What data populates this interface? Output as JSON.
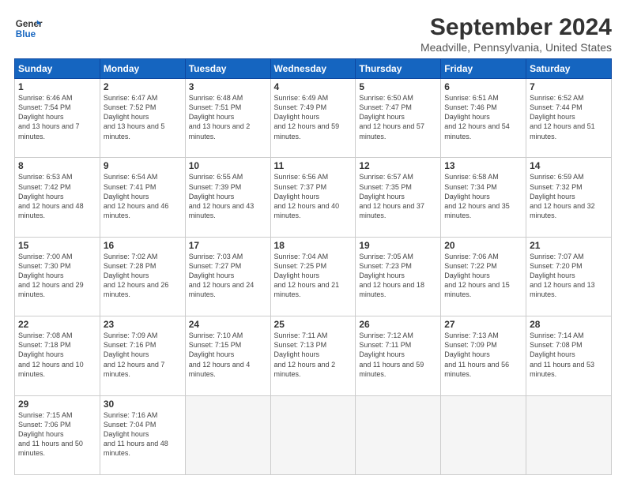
{
  "header": {
    "logo_line1": "General",
    "logo_line2": "Blue",
    "title": "September 2024",
    "subtitle": "Meadville, Pennsylvania, United States"
  },
  "calendar": {
    "days_of_week": [
      "Sunday",
      "Monday",
      "Tuesday",
      "Wednesday",
      "Thursday",
      "Friday",
      "Saturday"
    ],
    "weeks": [
      [
        {
          "num": "1",
          "sunrise": "6:46 AM",
          "sunset": "7:54 PM",
          "daylight": "13 hours and 7 minutes."
        },
        {
          "num": "2",
          "sunrise": "6:47 AM",
          "sunset": "7:52 PM",
          "daylight": "13 hours and 5 minutes."
        },
        {
          "num": "3",
          "sunrise": "6:48 AM",
          "sunset": "7:51 PM",
          "daylight": "13 hours and 2 minutes."
        },
        {
          "num": "4",
          "sunrise": "6:49 AM",
          "sunset": "7:49 PM",
          "daylight": "12 hours and 59 minutes."
        },
        {
          "num": "5",
          "sunrise": "6:50 AM",
          "sunset": "7:47 PM",
          "daylight": "12 hours and 57 minutes."
        },
        {
          "num": "6",
          "sunrise": "6:51 AM",
          "sunset": "7:46 PM",
          "daylight": "12 hours and 54 minutes."
        },
        {
          "num": "7",
          "sunrise": "6:52 AM",
          "sunset": "7:44 PM",
          "daylight": "12 hours and 51 minutes."
        }
      ],
      [
        {
          "num": "8",
          "sunrise": "6:53 AM",
          "sunset": "7:42 PM",
          "daylight": "12 hours and 48 minutes."
        },
        {
          "num": "9",
          "sunrise": "6:54 AM",
          "sunset": "7:41 PM",
          "daylight": "12 hours and 46 minutes."
        },
        {
          "num": "10",
          "sunrise": "6:55 AM",
          "sunset": "7:39 PM",
          "daylight": "12 hours and 43 minutes."
        },
        {
          "num": "11",
          "sunrise": "6:56 AM",
          "sunset": "7:37 PM",
          "daylight": "12 hours and 40 minutes."
        },
        {
          "num": "12",
          "sunrise": "6:57 AM",
          "sunset": "7:35 PM",
          "daylight": "12 hours and 37 minutes."
        },
        {
          "num": "13",
          "sunrise": "6:58 AM",
          "sunset": "7:34 PM",
          "daylight": "12 hours and 35 minutes."
        },
        {
          "num": "14",
          "sunrise": "6:59 AM",
          "sunset": "7:32 PM",
          "daylight": "12 hours and 32 minutes."
        }
      ],
      [
        {
          "num": "15",
          "sunrise": "7:00 AM",
          "sunset": "7:30 PM",
          "daylight": "12 hours and 29 minutes."
        },
        {
          "num": "16",
          "sunrise": "7:02 AM",
          "sunset": "7:28 PM",
          "daylight": "12 hours and 26 minutes."
        },
        {
          "num": "17",
          "sunrise": "7:03 AM",
          "sunset": "7:27 PM",
          "daylight": "12 hours and 24 minutes."
        },
        {
          "num": "18",
          "sunrise": "7:04 AM",
          "sunset": "7:25 PM",
          "daylight": "12 hours and 21 minutes."
        },
        {
          "num": "19",
          "sunrise": "7:05 AM",
          "sunset": "7:23 PM",
          "daylight": "12 hours and 18 minutes."
        },
        {
          "num": "20",
          "sunrise": "7:06 AM",
          "sunset": "7:22 PM",
          "daylight": "12 hours and 15 minutes."
        },
        {
          "num": "21",
          "sunrise": "7:07 AM",
          "sunset": "7:20 PM",
          "daylight": "12 hours and 13 minutes."
        }
      ],
      [
        {
          "num": "22",
          "sunrise": "7:08 AM",
          "sunset": "7:18 PM",
          "daylight": "12 hours and 10 minutes."
        },
        {
          "num": "23",
          "sunrise": "7:09 AM",
          "sunset": "7:16 PM",
          "daylight": "12 hours and 7 minutes."
        },
        {
          "num": "24",
          "sunrise": "7:10 AM",
          "sunset": "7:15 PM",
          "daylight": "12 hours and 4 minutes."
        },
        {
          "num": "25",
          "sunrise": "7:11 AM",
          "sunset": "7:13 PM",
          "daylight": "12 hours and 2 minutes."
        },
        {
          "num": "26",
          "sunrise": "7:12 AM",
          "sunset": "7:11 PM",
          "daylight": "11 hours and 59 minutes."
        },
        {
          "num": "27",
          "sunrise": "7:13 AM",
          "sunset": "7:09 PM",
          "daylight": "11 hours and 56 minutes."
        },
        {
          "num": "28",
          "sunrise": "7:14 AM",
          "sunset": "7:08 PM",
          "daylight": "11 hours and 53 minutes."
        }
      ],
      [
        {
          "num": "29",
          "sunrise": "7:15 AM",
          "sunset": "7:06 PM",
          "daylight": "11 hours and 50 minutes."
        },
        {
          "num": "30",
          "sunrise": "7:16 AM",
          "sunset": "7:04 PM",
          "daylight": "11 hours and 48 minutes."
        },
        null,
        null,
        null,
        null,
        null
      ]
    ]
  }
}
